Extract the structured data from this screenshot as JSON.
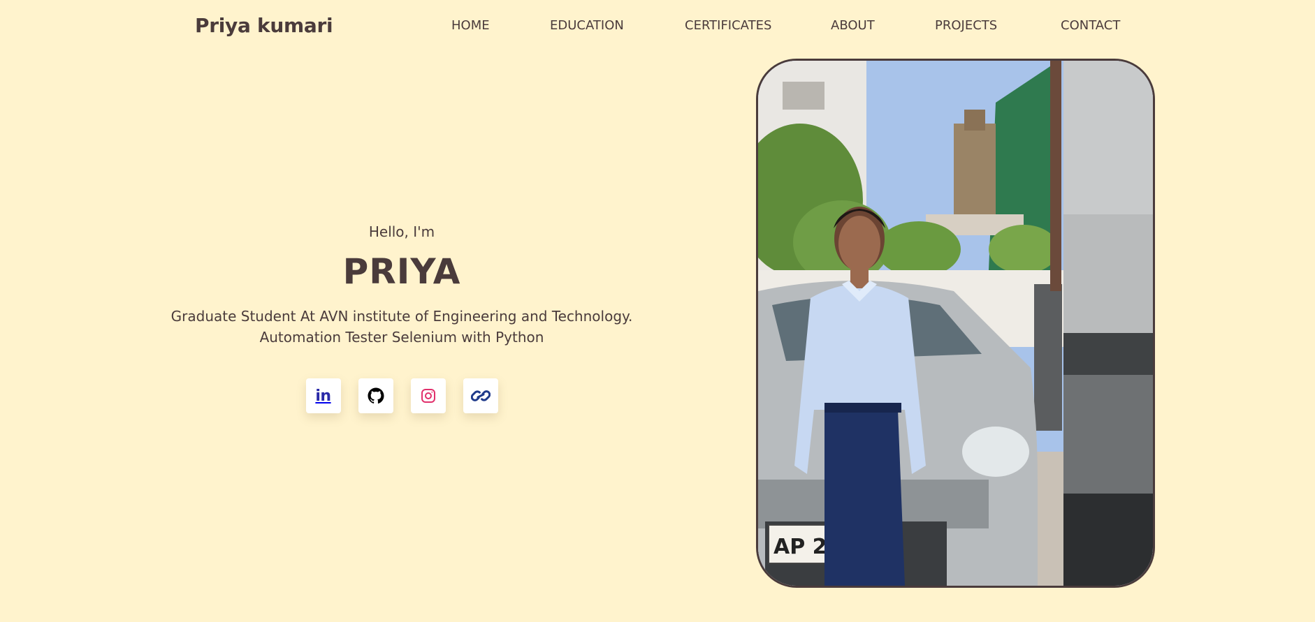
{
  "header": {
    "logo": "Priya kumari",
    "nav": [
      {
        "label": "HOME"
      },
      {
        "label": "EDUCATION"
      },
      {
        "label": "CERTIFICATES"
      },
      {
        "label": "ABOUT"
      },
      {
        "label": "PROJECTS"
      },
      {
        "label": "CONTACT"
      }
    ]
  },
  "hero": {
    "greeting": "Hello, I'm",
    "name": "PRIYA",
    "description_line1": "Graduate Student At AVN institute of Engineering and Technology.",
    "description_line2": "Automation Tester Selenium with Python",
    "socials": [
      {
        "icon": "linkedin-icon",
        "label": "in",
        "color": "#2a2aa8"
      },
      {
        "icon": "github-icon",
        "color": "#000000"
      },
      {
        "icon": "instagram-icon",
        "color": "#e1306c"
      },
      {
        "icon": "link-icon",
        "color": "#1f3a8a"
      }
    ],
    "photo": {
      "plate_text": "AP 23 AK"
    }
  },
  "colors": {
    "background": "#fff3cd",
    "text": "#4a3b3b"
  }
}
